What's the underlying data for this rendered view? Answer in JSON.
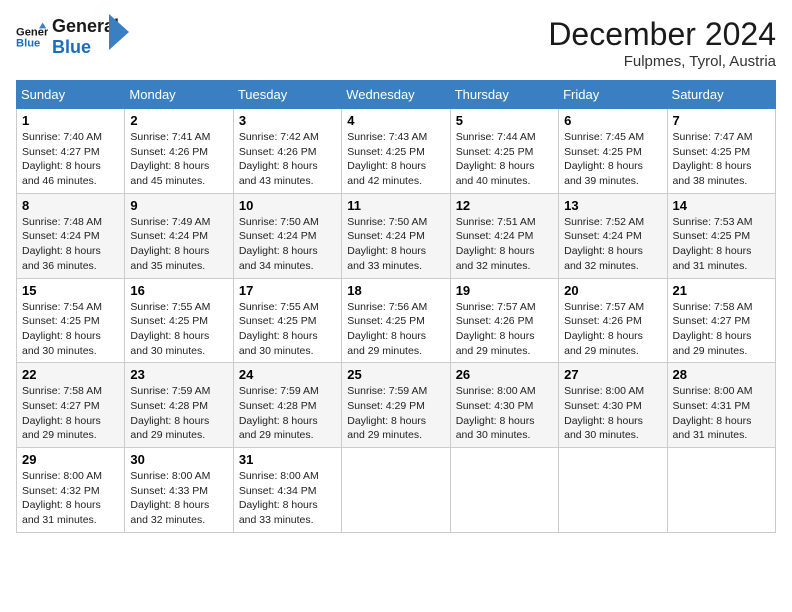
{
  "logo": {
    "general": "General",
    "blue": "Blue"
  },
  "title": "December 2024",
  "location": "Fulpmes, Tyrol, Austria",
  "days_of_week": [
    "Sunday",
    "Monday",
    "Tuesday",
    "Wednesday",
    "Thursday",
    "Friday",
    "Saturday"
  ],
  "weeks": [
    [
      {
        "day": "1",
        "sunrise": "7:40 AM",
        "sunset": "4:27 PM",
        "daylight": "8 hours and 46 minutes."
      },
      {
        "day": "2",
        "sunrise": "7:41 AM",
        "sunset": "4:26 PM",
        "daylight": "8 hours and 45 minutes."
      },
      {
        "day": "3",
        "sunrise": "7:42 AM",
        "sunset": "4:26 PM",
        "daylight": "8 hours and 43 minutes."
      },
      {
        "day": "4",
        "sunrise": "7:43 AM",
        "sunset": "4:25 PM",
        "daylight": "8 hours and 42 minutes."
      },
      {
        "day": "5",
        "sunrise": "7:44 AM",
        "sunset": "4:25 PM",
        "daylight": "8 hours and 40 minutes."
      },
      {
        "day": "6",
        "sunrise": "7:45 AM",
        "sunset": "4:25 PM",
        "daylight": "8 hours and 39 minutes."
      },
      {
        "day": "7",
        "sunrise": "7:47 AM",
        "sunset": "4:25 PM",
        "daylight": "8 hours and 38 minutes."
      }
    ],
    [
      {
        "day": "8",
        "sunrise": "7:48 AM",
        "sunset": "4:24 PM",
        "daylight": "8 hours and 36 minutes."
      },
      {
        "day": "9",
        "sunrise": "7:49 AM",
        "sunset": "4:24 PM",
        "daylight": "8 hours and 35 minutes."
      },
      {
        "day": "10",
        "sunrise": "7:50 AM",
        "sunset": "4:24 PM",
        "daylight": "8 hours and 34 minutes."
      },
      {
        "day": "11",
        "sunrise": "7:50 AM",
        "sunset": "4:24 PM",
        "daylight": "8 hours and 33 minutes."
      },
      {
        "day": "12",
        "sunrise": "7:51 AM",
        "sunset": "4:24 PM",
        "daylight": "8 hours and 32 minutes."
      },
      {
        "day": "13",
        "sunrise": "7:52 AM",
        "sunset": "4:24 PM",
        "daylight": "8 hours and 32 minutes."
      },
      {
        "day": "14",
        "sunrise": "7:53 AM",
        "sunset": "4:25 PM",
        "daylight": "8 hours and 31 minutes."
      }
    ],
    [
      {
        "day": "15",
        "sunrise": "7:54 AM",
        "sunset": "4:25 PM",
        "daylight": "8 hours and 30 minutes."
      },
      {
        "day": "16",
        "sunrise": "7:55 AM",
        "sunset": "4:25 PM",
        "daylight": "8 hours and 30 minutes."
      },
      {
        "day": "17",
        "sunrise": "7:55 AM",
        "sunset": "4:25 PM",
        "daylight": "8 hours and 30 minutes."
      },
      {
        "day": "18",
        "sunrise": "7:56 AM",
        "sunset": "4:25 PM",
        "daylight": "8 hours and 29 minutes."
      },
      {
        "day": "19",
        "sunrise": "7:57 AM",
        "sunset": "4:26 PM",
        "daylight": "8 hours and 29 minutes."
      },
      {
        "day": "20",
        "sunrise": "7:57 AM",
        "sunset": "4:26 PM",
        "daylight": "8 hours and 29 minutes."
      },
      {
        "day": "21",
        "sunrise": "7:58 AM",
        "sunset": "4:27 PM",
        "daylight": "8 hours and 29 minutes."
      }
    ],
    [
      {
        "day": "22",
        "sunrise": "7:58 AM",
        "sunset": "4:27 PM",
        "daylight": "8 hours and 29 minutes."
      },
      {
        "day": "23",
        "sunrise": "7:59 AM",
        "sunset": "4:28 PM",
        "daylight": "8 hours and 29 minutes."
      },
      {
        "day": "24",
        "sunrise": "7:59 AM",
        "sunset": "4:28 PM",
        "daylight": "8 hours and 29 minutes."
      },
      {
        "day": "25",
        "sunrise": "7:59 AM",
        "sunset": "4:29 PM",
        "daylight": "8 hours and 29 minutes."
      },
      {
        "day": "26",
        "sunrise": "8:00 AM",
        "sunset": "4:30 PM",
        "daylight": "8 hours and 30 minutes."
      },
      {
        "day": "27",
        "sunrise": "8:00 AM",
        "sunset": "4:30 PM",
        "daylight": "8 hours and 30 minutes."
      },
      {
        "day": "28",
        "sunrise": "8:00 AM",
        "sunset": "4:31 PM",
        "daylight": "8 hours and 31 minutes."
      }
    ],
    [
      {
        "day": "29",
        "sunrise": "8:00 AM",
        "sunset": "4:32 PM",
        "daylight": "8 hours and 31 minutes."
      },
      {
        "day": "30",
        "sunrise": "8:00 AM",
        "sunset": "4:33 PM",
        "daylight": "8 hours and 32 minutes."
      },
      {
        "day": "31",
        "sunrise": "8:00 AM",
        "sunset": "4:34 PM",
        "daylight": "8 hours and 33 minutes."
      },
      null,
      null,
      null,
      null
    ]
  ],
  "labels": {
    "sunrise": "Sunrise:",
    "sunset": "Sunset:",
    "daylight": "Daylight:"
  }
}
